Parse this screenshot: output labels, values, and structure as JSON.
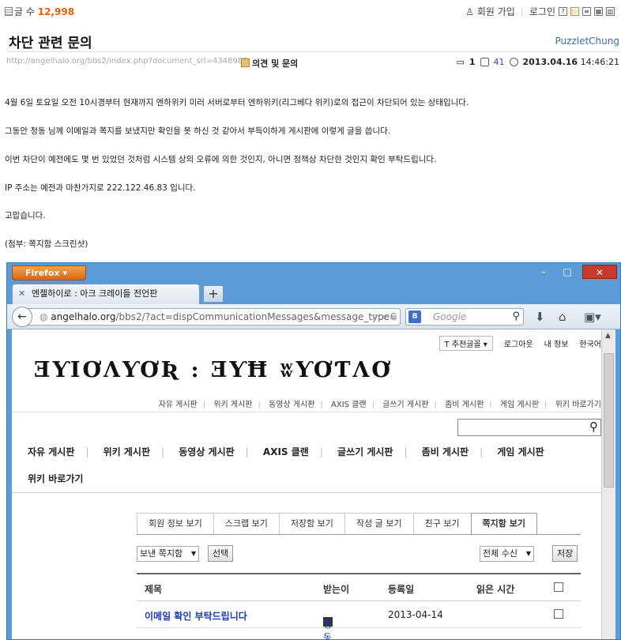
{
  "header": {
    "post_count_label": "글 수",
    "post_count": "12,998",
    "signup": "회원 가입",
    "login": "로그인",
    "icons": [
      "question-icon",
      "flag-icon",
      "list-icon",
      "grid-icon",
      "columns-icon"
    ]
  },
  "post": {
    "title": "차단 관련 문의",
    "author": "PuzzletChung",
    "url": "http://angelhalo.org/bbs2/index.php?document_srl=4348987",
    "category": "의견 및 문의",
    "comments": "1",
    "views": "41",
    "date": "2013.04.16",
    "time": "14:46:21",
    "paragraphs": [
      "4월 6일 토요일 오전 10시경부터 현재까지 엔하위키 미러 서버로부터 엔하위키(리그베다 위키)로의 접근이 차단되어 있는 상태입니다.",
      "그동안 청동 님께 이메일과 쪽지를 보냈지만 확인을 못 하신 것 같아서 부득이하게 게시판에 이렇게 글을 씁니다.",
      "이번 차단이 예전에도 몇 번 있었던 것처럼 시스템 상의 오류에 의한 것인지, 아니면 정책상 차단한 것인지 확인 부탁드립니다.",
      "IP 주소는 예전과 마찬가지로 222.122.46.83 입니다.",
      "고맙습니다.",
      "(첨부: 쪽지함 스크린샷)"
    ]
  },
  "browser": {
    "app_button": "Firefox",
    "tab_title": "엔젤하이로 : 아크 크레이들 전언판",
    "url_host": "angelhalo.org",
    "url_path": "/bbs2/?act=dispCommunicationMessages&message_type=",
    "search_placeholder": "Google",
    "site": {
      "font_select": "T 추천글꼴",
      "logout": "로그아웃",
      "my_info": "내 정보",
      "language": "한국어",
      "logo_text": "ƎƳIƠɅƳƠƦ : ƎƳĦ ʬƳƠƬɅƠ",
      "small_nav": [
        "자유 게시판",
        "위키 게시판",
        "동영상 게시판",
        "AXIS 클랜",
        "글쓰기 게시판",
        "좀비 게시판",
        "게임 게시판",
        "위키 바로가기"
      ],
      "big_nav": [
        "자유 게시판",
        "위키 게시판",
        "동영상 게시판",
        "AXIS 클랜",
        "글쓰기 게시판",
        "좀비 게시판",
        "게임 게시판"
      ],
      "big_nav_row2": "위키 바로가기",
      "member_tabs": [
        "회원 정보 보기",
        "스크랩 보기",
        "저장함 보기",
        "작성 글 보기",
        "친구 보기",
        "쪽지함 보기"
      ],
      "box_select": "보낸 쪽지함",
      "select_button": "선택",
      "filter_select": "전체 수신",
      "save_button": "저장",
      "table": {
        "headers": [
          "제목",
          "받는이",
          "등록일",
          "읽은 시간"
        ],
        "rows": [
          {
            "subject": "이메일 확인 부탁드립니다",
            "receiver": "청동",
            "date": "2013-04-14",
            "read_time": ""
          }
        ]
      }
    }
  }
}
